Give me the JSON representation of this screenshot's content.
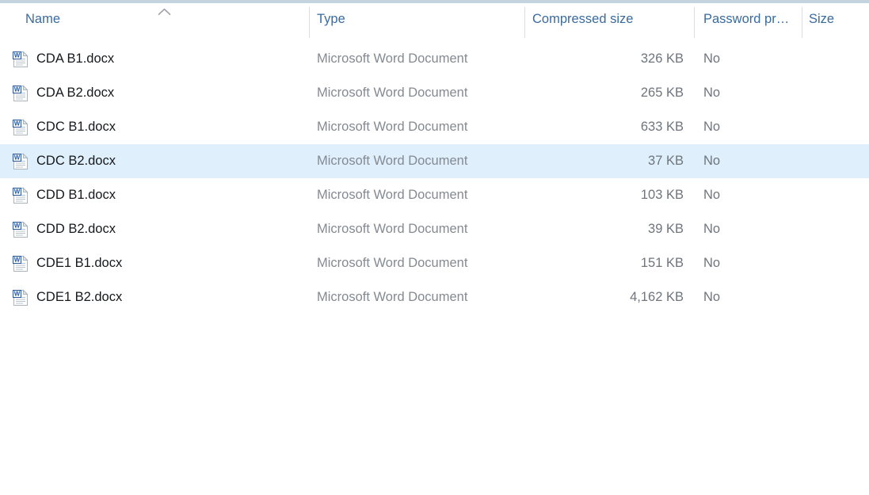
{
  "window": {
    "view": "details",
    "accent_bar_color": "#c3d4e0",
    "selection_color": "#dfeffc"
  },
  "columns": [
    {
      "key": "name",
      "label": "Name",
      "sorted": true,
      "sort_direction": "ascending",
      "sort_icon": "chevron-up-icon",
      "align": "left"
    },
    {
      "key": "type",
      "label": "Type",
      "sorted": false,
      "align": "left"
    },
    {
      "key": "csize",
      "label": "Compressed size",
      "sorted": false,
      "align": "left"
    },
    {
      "key": "password",
      "label": "Password pr…",
      "sorted": false,
      "align": "left"
    },
    {
      "key": "size",
      "label": "Size",
      "sorted": false,
      "align": "left"
    }
  ],
  "files": [
    {
      "icon": "word-document-icon",
      "name": "CDA B1.docx",
      "type": "Microsoft Word Document",
      "compressed_size": "326 KB",
      "password_protected": "No",
      "size": "",
      "selected": false
    },
    {
      "icon": "word-document-icon",
      "name": "CDA B2.docx",
      "type": "Microsoft Word Document",
      "compressed_size": "265 KB",
      "password_protected": "No",
      "size": "",
      "selected": false
    },
    {
      "icon": "word-document-icon",
      "name": "CDC B1.docx",
      "type": "Microsoft Word Document",
      "compressed_size": "633 KB",
      "password_protected": "No",
      "size": "",
      "selected": false
    },
    {
      "icon": "word-document-icon",
      "name": "CDC B2.docx",
      "type": "Microsoft Word Document",
      "compressed_size": "37 KB",
      "password_protected": "No",
      "size": "",
      "selected": true
    },
    {
      "icon": "word-document-icon",
      "name": "CDD B1.docx",
      "type": "Microsoft Word Document",
      "compressed_size": "103 KB",
      "password_protected": "No",
      "size": "",
      "selected": false
    },
    {
      "icon": "word-document-icon",
      "name": "CDD B2.docx",
      "type": "Microsoft Word Document",
      "compressed_size": "39 KB",
      "password_protected": "No",
      "size": "",
      "selected": false
    },
    {
      "icon": "word-document-icon",
      "name": "CDE1 B1.docx",
      "type": "Microsoft Word Document",
      "compressed_size": "151 KB",
      "password_protected": "No",
      "size": "",
      "selected": false
    },
    {
      "icon": "word-document-icon",
      "name": "CDE1 B2.docx",
      "type": "Microsoft Word Document",
      "compressed_size": "4,162 KB",
      "password_protected": "No",
      "size": "",
      "selected": false
    }
  ]
}
